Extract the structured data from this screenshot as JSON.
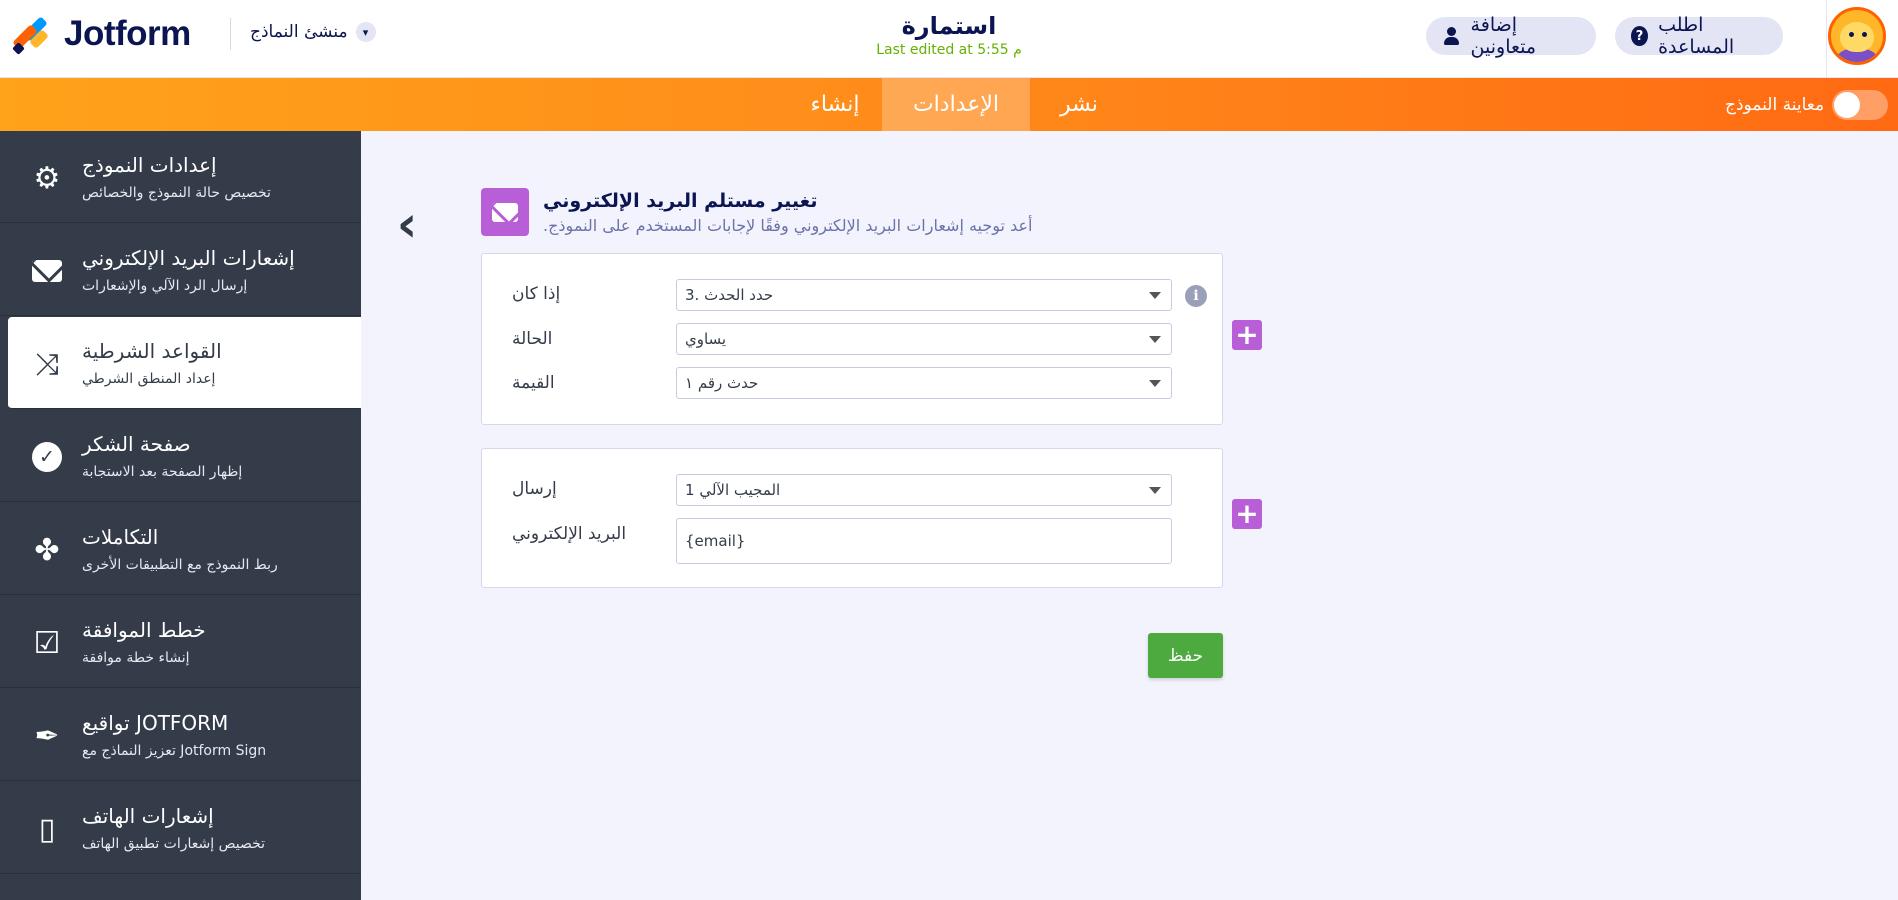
{
  "header": {
    "logo_text": "Jotform",
    "builder_label": "منشئ النماذج",
    "form_title": "استمارة",
    "last_edited": "Last edited at 5:55 م",
    "help_label": "اطلب المساعدة",
    "collab_label": "إضافة متعاونين"
  },
  "nav": {
    "tabs": [
      {
        "label": "نشر"
      },
      {
        "label": "الإعدادات"
      },
      {
        "label": "إنشاء"
      }
    ],
    "active_tab": "الإعدادات",
    "preview_label": "معاينة النموذج",
    "preview_on": false
  },
  "sidebar": {
    "items": [
      {
        "title": "إعدادات النموذج",
        "subtitle": "تخصيص حالة النموذج والخصائص",
        "icon": "gear-icon"
      },
      {
        "title": "إشعارات البريد الإلكتروني",
        "subtitle": "إرسال الرد الآلي والإشعارات",
        "icon": "envelope-icon"
      },
      {
        "title": "القواعد الشرطية",
        "subtitle": "إعداد المنطق الشرطي",
        "icon": "shuffle-icon"
      },
      {
        "title": "صفحة الشكر",
        "subtitle": "إظهار الصفحة بعد الاستجابة",
        "icon": "check-circle-icon"
      },
      {
        "title": "التكاملات",
        "subtitle": "ربط النموذج مع التطبيقات الأخرى",
        "icon": "puzzle-icon"
      },
      {
        "title": "خطط الموافقة",
        "subtitle": "إنشاء خطة موافقة",
        "icon": "approval-icon"
      },
      {
        "title": "تواقيع JOTFORM",
        "subtitle": "تعزيز النماذج مع Jotform Sign",
        "icon": "pen-icon"
      },
      {
        "title": "إشعارات الهاتف",
        "subtitle": "تخصيص إشعارات تطبيق الهاتف",
        "icon": "mobile-icon"
      }
    ],
    "active_index": 2
  },
  "main": {
    "title": "تغيير مستلم البريد الإلكتروني",
    "description": ".أعد توجيه إشعارات البريد الإلكتروني وفقًا لإجابات المستخدم على النموذج",
    "condition": {
      "if_label": "إذا كان",
      "if_value": "3. حدد الحدث",
      "state_label": "الحالة",
      "state_value": "يساوي",
      "value_label": "القيمة",
      "value_value": "حدث رقم ١"
    },
    "action": {
      "send_label": "إرسال",
      "send_value": "المجيب الآلي 1",
      "email_label": "البريد الإلكتروني",
      "email_value": "{email}"
    },
    "save_label": "حفظ"
  },
  "colors": {
    "accent_orange": "#ff8a1a",
    "sidebar_bg": "#343c4a",
    "purple": "#b85ed6",
    "save_green": "#4caa3e",
    "edited_green": "#64b200"
  }
}
